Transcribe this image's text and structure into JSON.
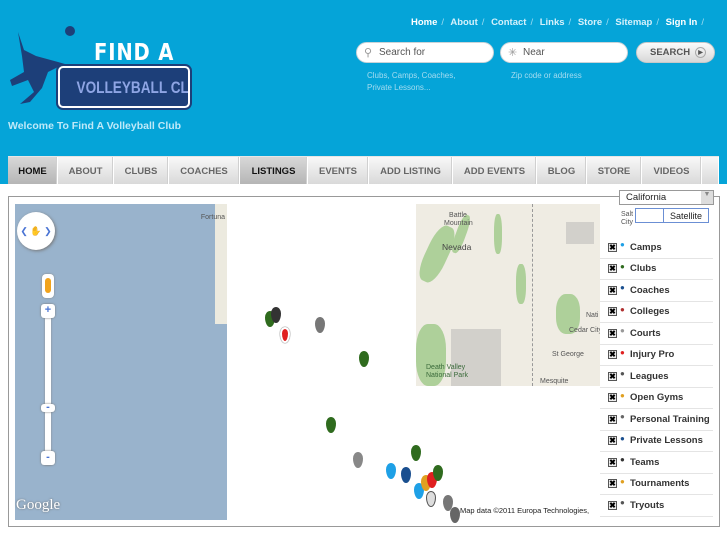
{
  "header": {
    "top_links": [
      "Home",
      "About",
      "Contact",
      "Links",
      "Store",
      "Sitemap",
      "Sign In"
    ],
    "logo_text_top": "FIND A",
    "logo_text_bottom": "VOLLEYBALL CLUB",
    "welcome": "Welcome To Find A Volleyball Club",
    "search": {
      "what_placeholder": "Search for",
      "what_hint_1": "Clubs, Camps, Coaches,",
      "what_hint_2": "Private Lessons...",
      "near_placeholder": "Near",
      "near_hint": "Zip code or address",
      "button": "SEARCH"
    }
  },
  "nav": {
    "items": [
      "HOME",
      "ABOUT",
      "CLUBS",
      "COACHES",
      "LISTINGS",
      "EVENTS",
      "ADD LISTING",
      "ADD EVENTS",
      "BLOG",
      "STORE",
      "VIDEOS"
    ],
    "active": [
      "HOME",
      "LISTINGS"
    ]
  },
  "map": {
    "state_select": "California",
    "map_type_buttons": [
      "",
      "Satellite"
    ],
    "labels": [
      "Fortuna",
      "Battle Mountain",
      "Nevada",
      "Death Valley National Park",
      "St George",
      "Mesquite",
      "Cedar City",
      "Salt Lake City",
      "Nati"
    ],
    "google_logo": "Google",
    "attribution": "Map data ©2011 Europa Technologies,",
    "legend": [
      {
        "label": "Camps",
        "color": "#1ea0e6"
      },
      {
        "label": "Clubs",
        "color": "#2f6b1e"
      },
      {
        "label": "Coaches",
        "color": "#1a4f8f"
      },
      {
        "label": "Colleges",
        "color": "#b03030"
      },
      {
        "label": "Courts",
        "color": "#999999"
      },
      {
        "label": "Injury Pro",
        "color": "#e02020"
      },
      {
        "label": "Leagues",
        "color": "#555555"
      },
      {
        "label": "Open Gyms",
        "color": "#e0a020"
      },
      {
        "label": "Personal Training",
        "color": "#666666"
      },
      {
        "label": "Private Lessons",
        "color": "#1a4f8f"
      },
      {
        "label": "Teams",
        "color": "#333333"
      },
      {
        "label": "Tournaments",
        "color": "#e0a020"
      },
      {
        "label": "Tryouts",
        "color": "#555555"
      }
    ]
  }
}
